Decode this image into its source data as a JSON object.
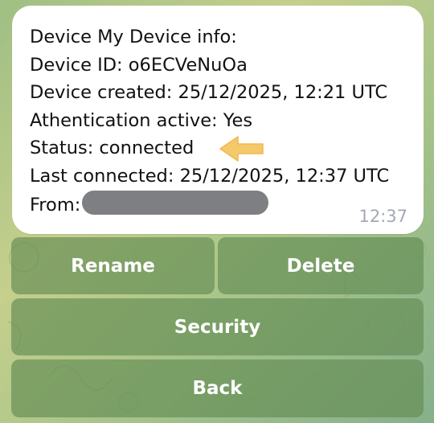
{
  "message": {
    "lines": [
      "Device My Device info:",
      "Device ID: o6ECVeNuOa",
      "Device created: 25/12/2025, 12:21 UTC",
      "Athentication active: Yes",
      "Status: connected",
      "Last connected: 25/12/2025, 12:37 UTC"
    ],
    "from_label": "From:",
    "time": "12:37",
    "annotation_arrow_color": "#f5c86b"
  },
  "keyboard": {
    "rename_label": "Rename",
    "delete_label": "Delete",
    "security_label": "Security",
    "back_label": "Back"
  },
  "colors": {
    "button_bg": "#638c54",
    "bubble_bg": "#ffffff",
    "time_color": "#a3a9b3"
  }
}
